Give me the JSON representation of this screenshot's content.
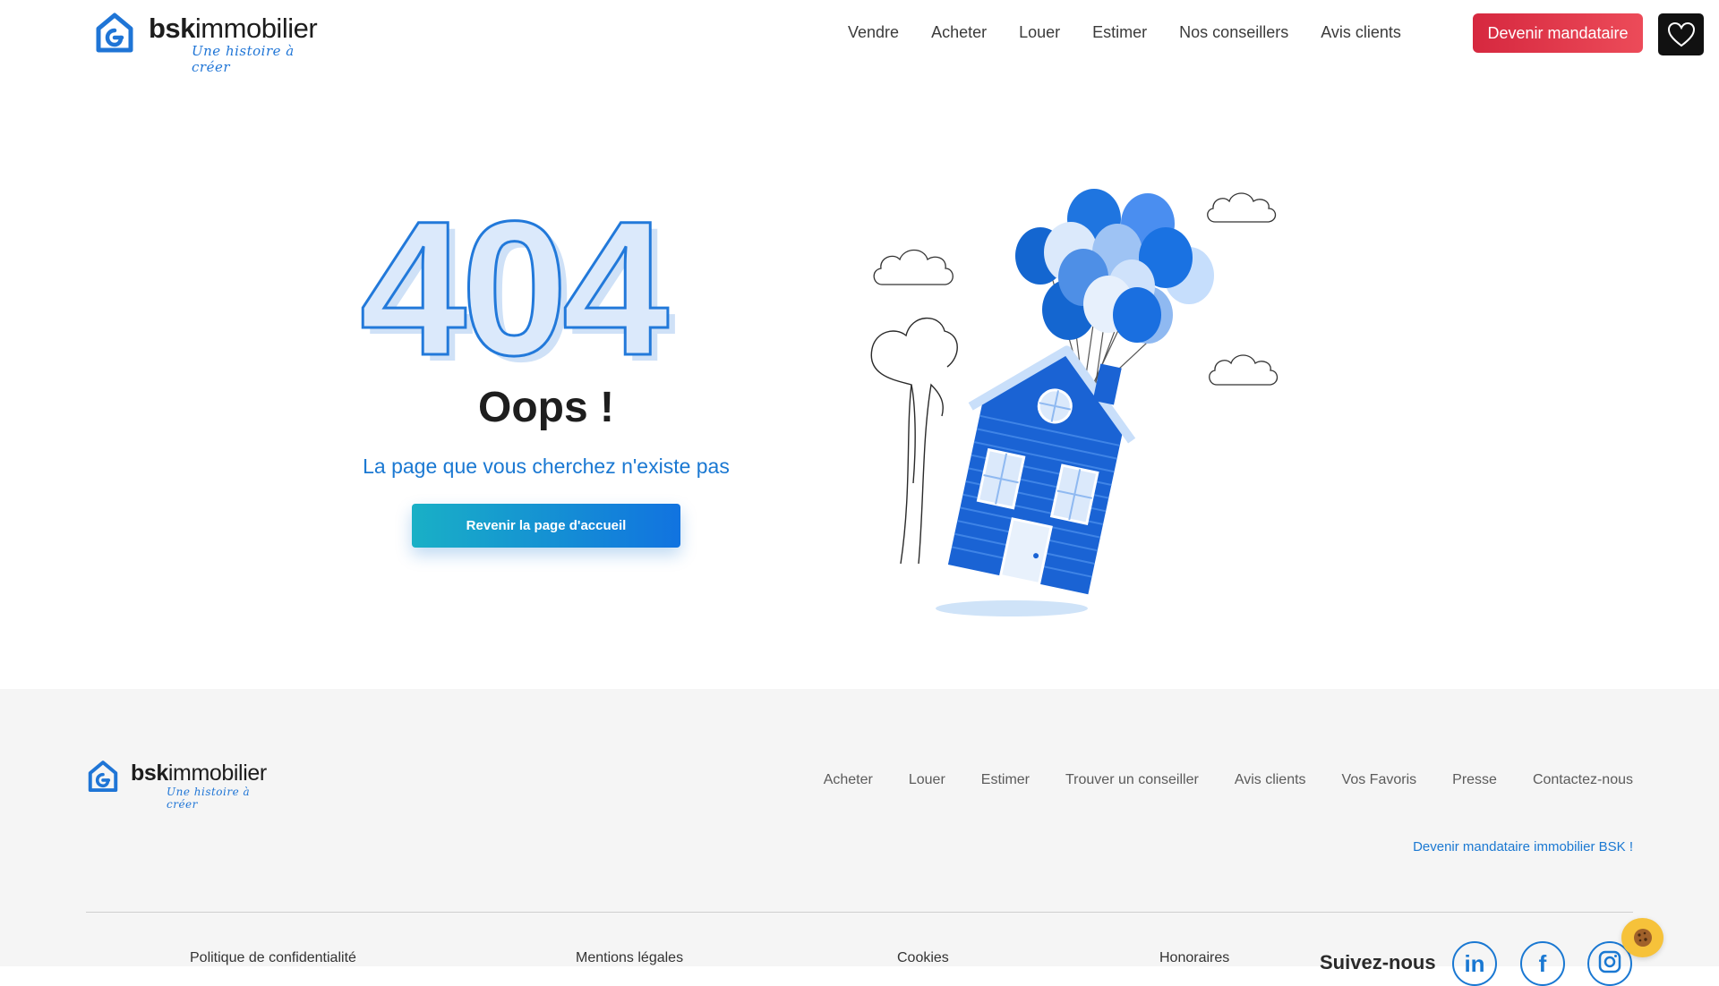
{
  "header": {
    "brand_bold": "bsk",
    "brand_rest": "immobilier",
    "tagline": "Une histoire à créer",
    "nav": [
      "Vendre",
      "Acheter",
      "Louer",
      "Estimer",
      "Nos conseillers",
      "Avis clients"
    ],
    "cta_label": "Devenir mandataire",
    "favorites_icon": "heart-icon"
  },
  "main": {
    "code": "404",
    "title": "Oops !",
    "subtitle": "La page que vous cherchez n'existe pas",
    "button_label": "Revenir la page d'accueil",
    "illustration": "house-with-balloons"
  },
  "footer": {
    "brand_bold": "bsk",
    "brand_rest": "immobilier",
    "tagline": "Une histoire à créer",
    "nav": [
      "Acheter",
      "Louer",
      "Estimer",
      "Trouver un conseiller",
      "Avis clients",
      "Vos Favoris",
      "Presse",
      "Contactez-nous"
    ],
    "cta_link": "Devenir mandataire immobilier BSK !",
    "legal": [
      "Politique de confidentialité",
      "Mentions légales",
      "Cookies",
      "Honoraires"
    ],
    "follow_label": "Suivez-nous",
    "social_icons": [
      "linkedin-icon",
      "facebook-icon",
      "instagram-icon"
    ],
    "cookie_icon": "cookie-icon"
  },
  "colors": {
    "primary_blue": "#1a78d2",
    "cta_red": "#d6283f",
    "footer_bg": "#f5f5f5",
    "cookie_yellow": "#f6c23a"
  }
}
